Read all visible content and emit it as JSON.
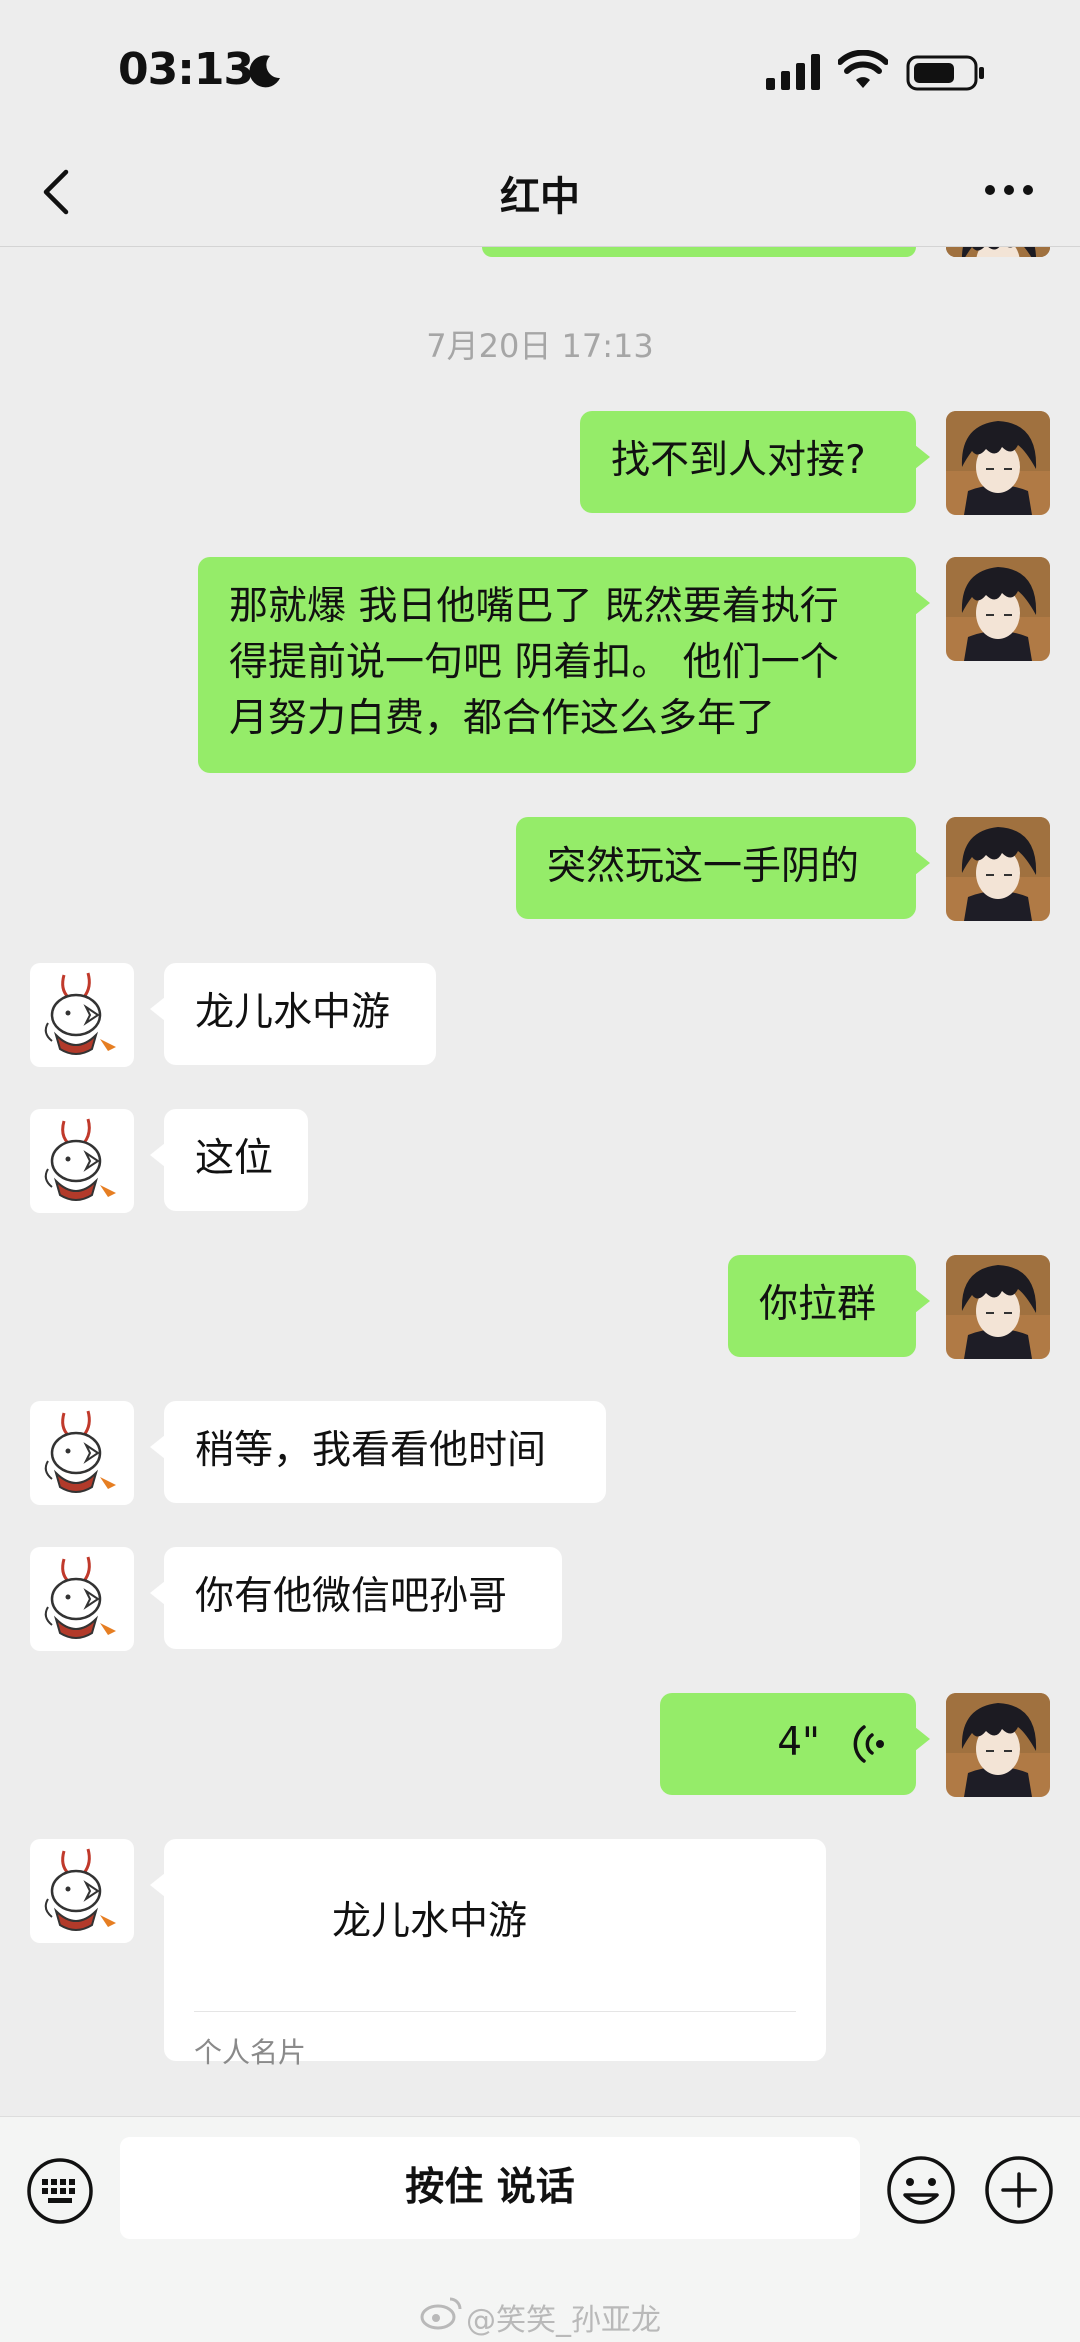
{
  "status_bar": {
    "time": "03:13"
  },
  "header": {
    "title": "红中"
  },
  "chat": {
    "timestamp": "7月20日 17:13",
    "messages": [
      {
        "sender": "me",
        "text": "找不到人对接?"
      },
      {
        "sender": "me",
        "text": "那就爆 我日他嘴巴了 既然要着执行\n得提前说一句吧 阴着扣。 他们一个\n月努力白费，都合作这么多年了"
      },
      {
        "sender": "me",
        "text": "突然玩这一手阴的"
      },
      {
        "sender": "them",
        "text": "龙儿水中游"
      },
      {
        "sender": "them",
        "text": "这位"
      },
      {
        "sender": "me",
        "text": "你拉群"
      },
      {
        "sender": "them",
        "text": "稍等，我看看他时间"
      },
      {
        "sender": "them",
        "text": "你有他微信吧孙哥"
      },
      {
        "sender": "me",
        "type": "voice",
        "duration": "4\""
      },
      {
        "sender": "them",
        "type": "contact-card",
        "name": "龙儿水中游",
        "card_type": "个人名片"
      }
    ]
  },
  "input_bar": {
    "talk_label": "按住 说话"
  },
  "watermark": {
    "text": "@笑笑_孙亚龙"
  }
}
